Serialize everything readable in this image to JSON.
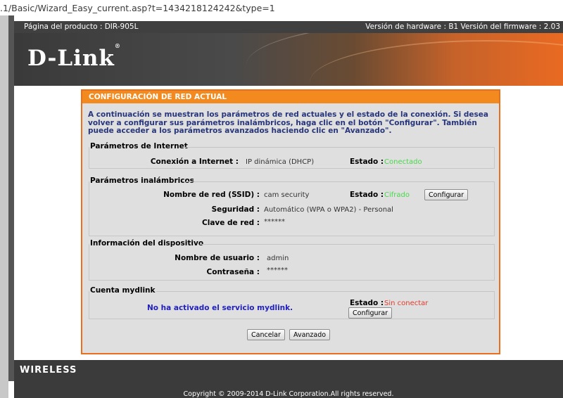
{
  "browser": {
    "url": ".1/Basic/Wizard_Easy_current.asp?t=1434218124242&type=1"
  },
  "header": {
    "product": "Página del producto : DIR-905L",
    "versions": "Versión de hardware : B1   Versión del firmware : 2.03",
    "logo": "D-Link"
  },
  "panel": {
    "title": "CONFIGURACIÓN DE RED ACTUAL",
    "intro": "A continuación se muestran los parámetros de red actuales y el estado de la conexión. Si desea volver a configurar sus parámetros inalámbricos, haga clic en el botón \"Configurar\". También puede acceder a los parámetros avanzados haciendo clic en \"Avanzado\"."
  },
  "internet": {
    "title": "Parámetros de Internet",
    "conn_label": "Conexión a Internet :",
    "conn_value": "IP dinámica (DHCP)",
    "status_label": "Estado :",
    "status_value": "Conectado"
  },
  "wireless": {
    "title": "Parámetros inalámbricos",
    "ssid_label": "Nombre de red (SSID) :",
    "ssid_value": "cam security",
    "status_label": "Estado :",
    "status_value": "Cifrado",
    "configure_label": "Configurar",
    "security_label": "Seguridad :",
    "security_value": "Automático (WPA o WPA2) - Personal",
    "key_label": "Clave de red :",
    "key_value": "******"
  },
  "device": {
    "title": "Información del dispositivo",
    "user_label": "Nombre de usuario :",
    "user_value": "admin",
    "pass_label": "Contraseña :",
    "pass_value": "******"
  },
  "mydlink": {
    "title": "Cuenta mydlink",
    "message": "No ha activado el servicio mydlink.",
    "status_label": "Estado :",
    "status_value": "Sin conectar",
    "configure_label": "Configurar"
  },
  "actions": {
    "cancel_label": "Cancelar",
    "advanced_label": "Avanzado"
  },
  "footer": {
    "section": "WIRELESS",
    "copyright": "Copyright © 2009-2014 D-Link Corporation.All rights reserved."
  },
  "colors": {
    "accent_orange": "#f28a1f",
    "status_ok": "#48d84a",
    "status_error": "#e13b2b",
    "link_blue": "#1f1fc2"
  }
}
